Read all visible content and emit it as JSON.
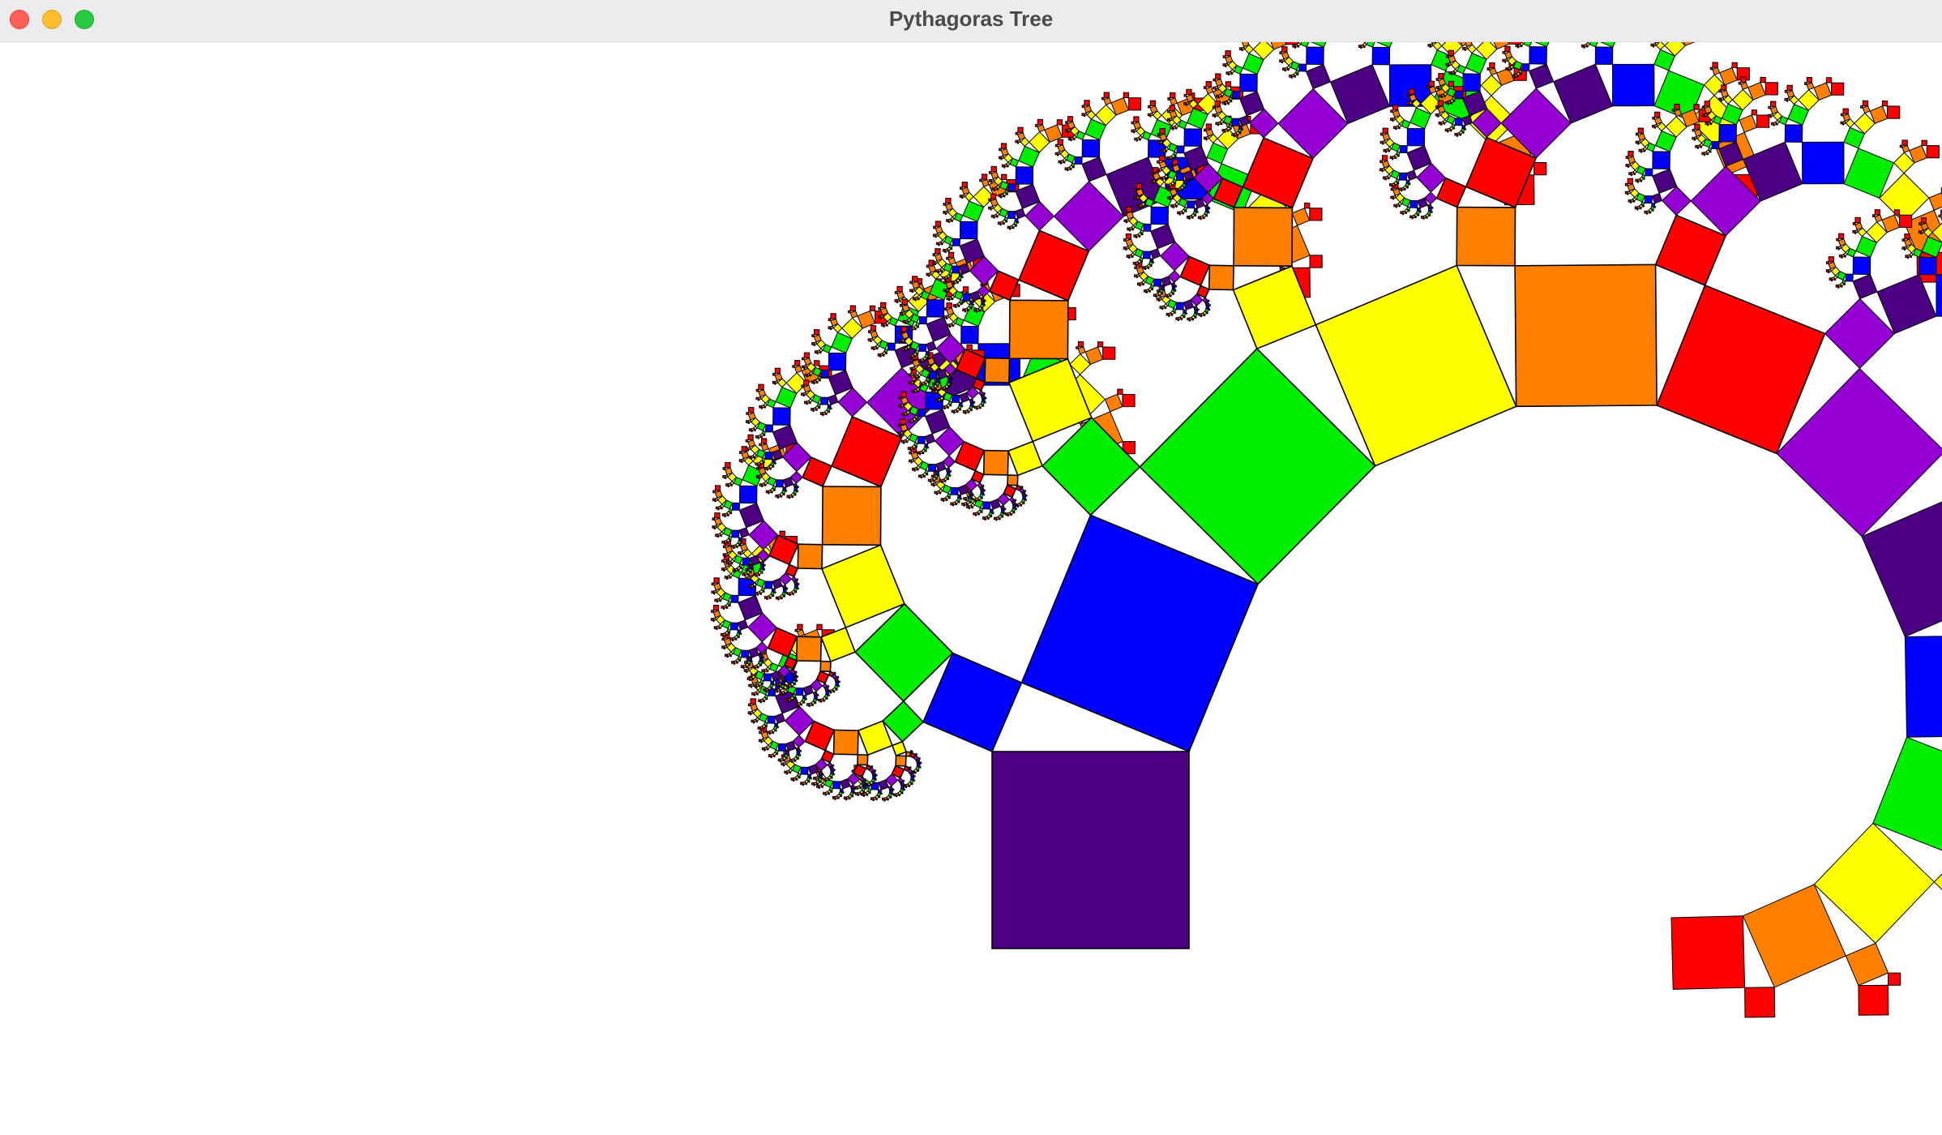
{
  "window": {
    "title": "Pythagoras Tree"
  },
  "tree": {
    "depth": 12,
    "colors": [
      "#4b0082",
      "#0000ff",
      "#00ee00",
      "#ffff00",
      "#ff8000",
      "#ff0000",
      "#9400d3"
    ],
    "stroke": "#000000",
    "background": "#ffffff"
  }
}
